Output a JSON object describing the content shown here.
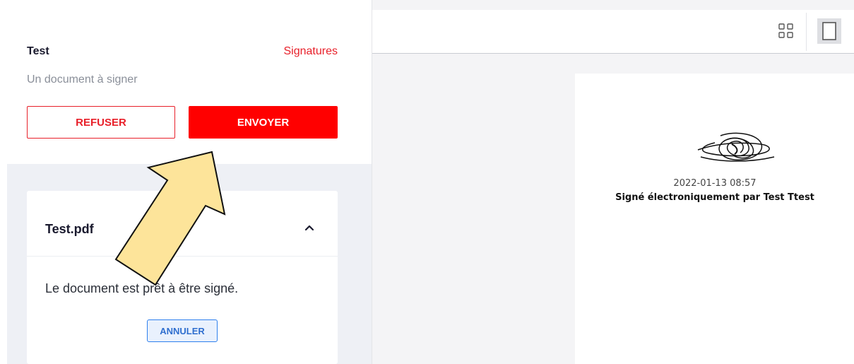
{
  "document": {
    "title": "Test",
    "signatures_link": "Signatures",
    "subtitle": "Un document à signer"
  },
  "actions": {
    "refuse_label": "REFUSER",
    "send_label": "ENVOYER"
  },
  "file_card": {
    "file_name": "Test.pdf",
    "status_message": "Le document est prêt à être signé.",
    "cancel_label": "ANNULER",
    "expanded": true
  },
  "viewer": {
    "toolbar_icons": [
      "grid-view-icon",
      "single-page-view-icon"
    ],
    "signature_block": {
      "timestamp": "2022-01-13 08:57",
      "signed_by_text": "Signé électroniquement par Test Ttest"
    }
  },
  "annotation": {
    "icon": "callout-arrow-icon",
    "fill_color": "#fde49a",
    "points_to": "ENVOYER"
  },
  "colors": {
    "accent_red": "#ff0000",
    "link_red": "#e8202a",
    "cancel_blue": "#2f80ed",
    "panel_background": "#eef0f5"
  }
}
